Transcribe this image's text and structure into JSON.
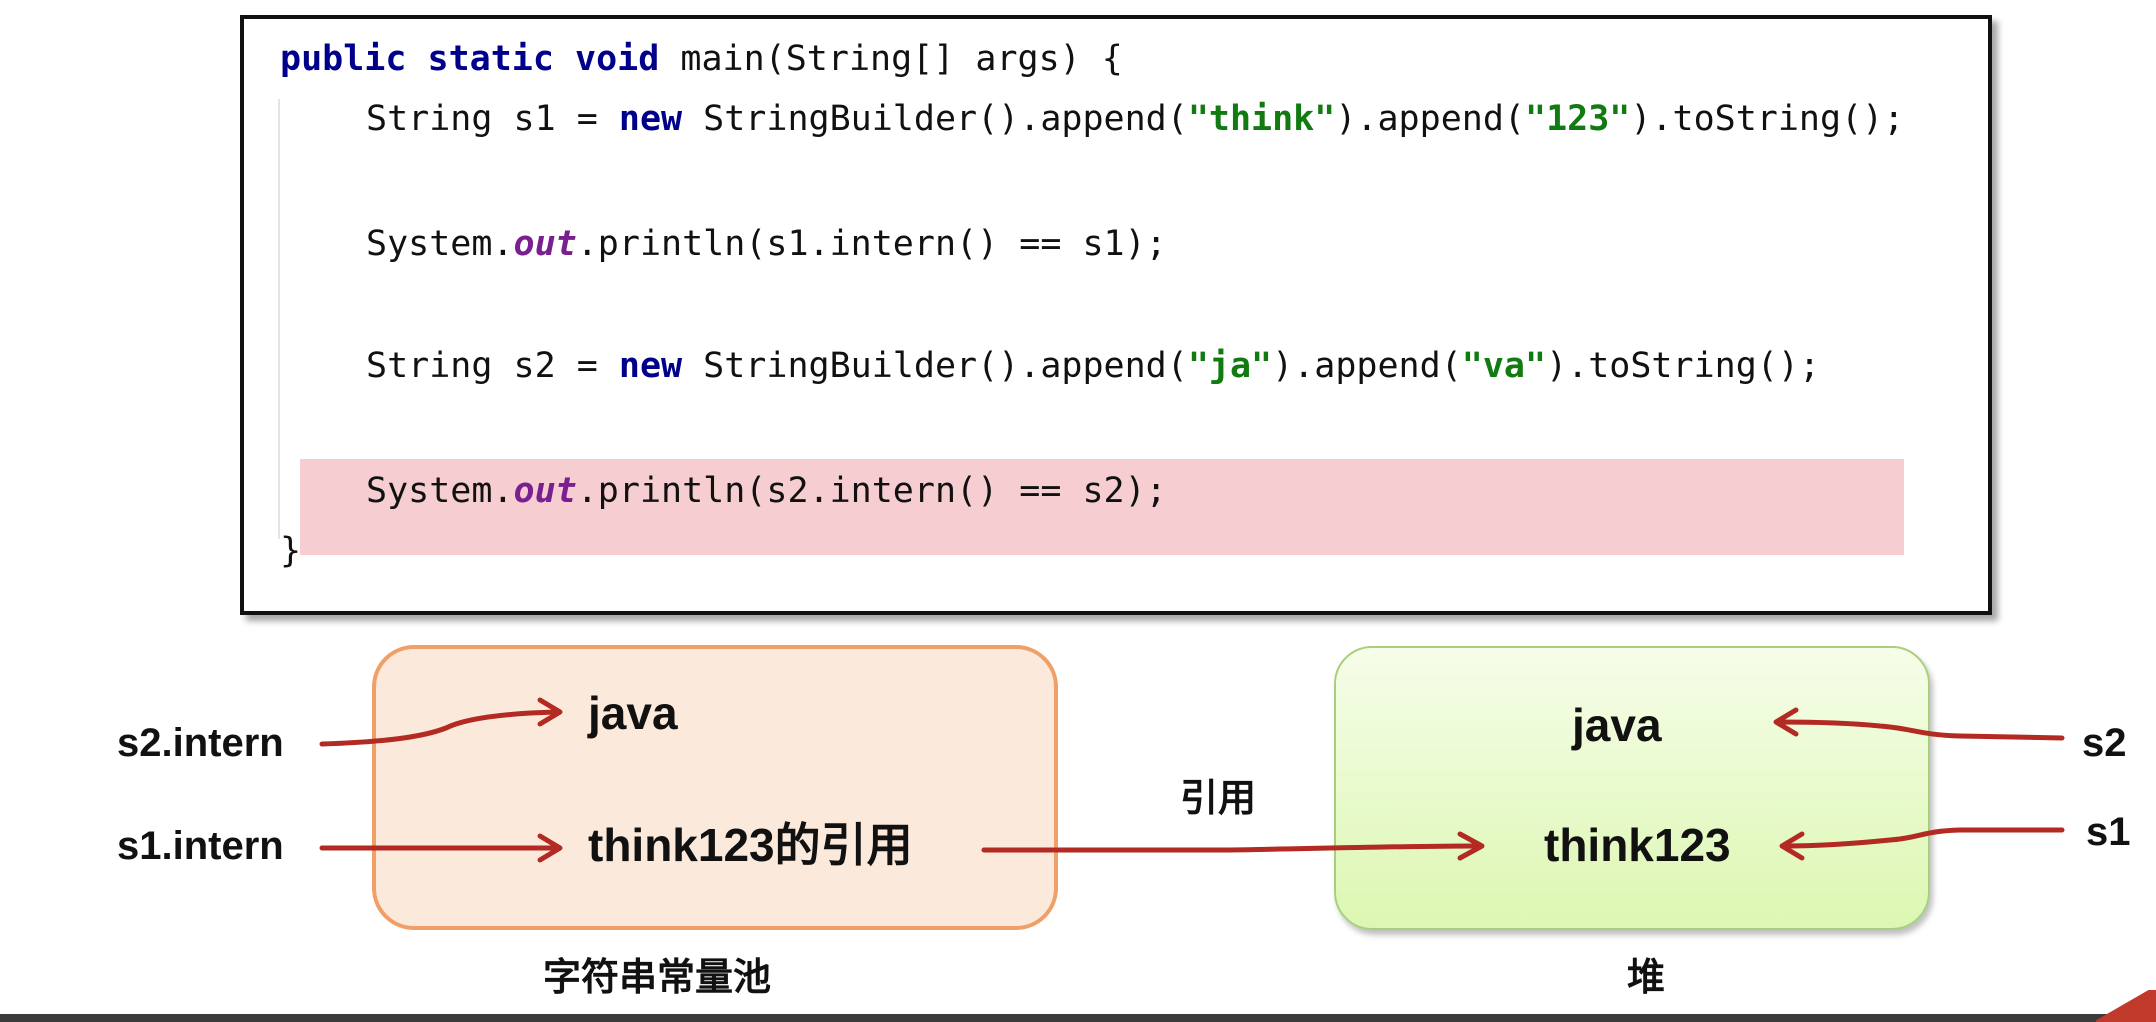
{
  "code": {
    "lines": [
      [
        {
          "t": "public static void",
          "c": "kw"
        },
        {
          "t": " main(String[] args) {",
          "c": "plain"
        }
      ],
      [
        {
          "t": "String s1 = ",
          "c": "plain"
        },
        {
          "t": "new",
          "c": "kw"
        },
        {
          "t": " StringBuilder().append(",
          "c": "plain"
        },
        {
          "t": "\"think\"",
          "c": "str"
        },
        {
          "t": ").append(",
          "c": "plain"
        },
        {
          "t": "\"123\"",
          "c": "str"
        },
        {
          "t": ").toString();",
          "c": "plain"
        }
      ],
      [
        {
          "t": "System.",
          "c": "plain"
        },
        {
          "t": "out",
          "c": "field"
        },
        {
          "t": ".println(s1.intern() == s1);",
          "c": "plain"
        }
      ],
      [
        {
          "t": "String s2 = ",
          "c": "plain"
        },
        {
          "t": "new",
          "c": "kw"
        },
        {
          "t": " StringBuilder().append(",
          "c": "plain"
        },
        {
          "t": "\"ja\"",
          "c": "str"
        },
        {
          "t": ").append(",
          "c": "plain"
        },
        {
          "t": "\"va\"",
          "c": "str"
        },
        {
          "t": ").toString();",
          "c": "plain"
        }
      ],
      [
        {
          "t": "System.",
          "c": "plain"
        },
        {
          "t": "out",
          "c": "field"
        },
        {
          "t": ".println(s2.intern() == s2);",
          "c": "plain"
        }
      ],
      [
        {
          "t": "}",
          "c": "plain"
        }
      ]
    ],
    "highlighted_line": 4
  },
  "diagram": {
    "pool": {
      "caption": "字符串常量池",
      "items": {
        "java": "java",
        "think_ref": "think123的引用"
      }
    },
    "heap": {
      "caption": "堆",
      "items": {
        "java": "java",
        "think": "think123"
      }
    },
    "refs": {
      "s2_intern": "s2.intern",
      "s1_intern": "s1.intern",
      "s2": "s2",
      "s1": "s1"
    },
    "link_label": "引用"
  },
  "colors": {
    "keyword": "#00008b",
    "string": "#117a11",
    "field": "#7a1f8f",
    "highlight": "#f6cdd0",
    "pool_fill": "#fbe9dc",
    "pool_border": "#f0a066",
    "heap_fill": "#dcf7b2",
    "arrow": "#b22a22"
  }
}
